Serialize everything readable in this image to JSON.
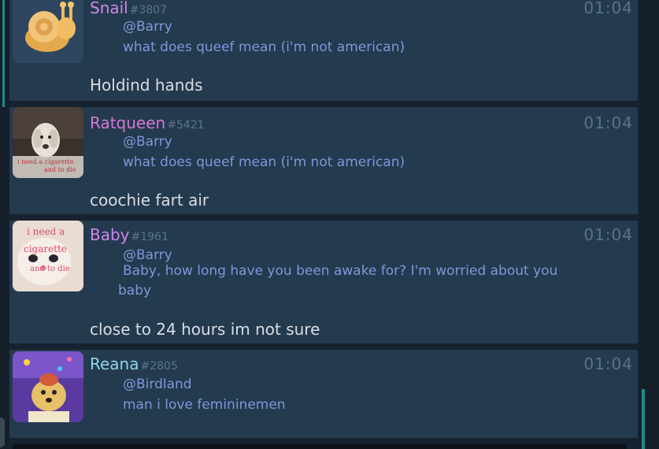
{
  "messages": [
    {
      "username": "Snail",
      "tag": "#3807",
      "time": "01:04",
      "name_color": "#cc88e8",
      "reply_to": "@Barry",
      "quoted_text": "what does queef mean (i'm not american)",
      "text": "Holdind hands",
      "avatar_icon": "snail-plush-avatar"
    },
    {
      "username": "Ratqueen",
      "tag": "#5421",
      "time": "01:04",
      "name_color": "#d678d6",
      "reply_to": "@Barry",
      "quoted_text": "what does queef mean (i'm not american)",
      "text": "coochie fart air",
      "avatar_icon": "dog-cigarette-avatar"
    },
    {
      "username": "Baby",
      "tag": "#1961",
      "time": "01:04",
      "name_color": "#cc88e8",
      "reply_to": "@Barry",
      "quoted_text_line1": "Baby, how long have you been awake for? I'm worried about you",
      "quoted_text_line2": "baby",
      "text": "close to 24 hours im not sure",
      "avatar_icon": "cat-cigarette-avatar",
      "avatar_text": "i need a cigarette"
    },
    {
      "username": "Reana",
      "tag": "#2805",
      "time": "01:04",
      "name_color": "#8fd6e8",
      "reply_to": "@Birdland",
      "quoted_text": "man i love femininemen",
      "avatar_icon": "puppy-party-avatar"
    }
  ],
  "colors": {
    "accent": "#1e8a8f",
    "card_bg": "#243a4f",
    "feed_bg": "#16222f",
    "mention": "#8097d8",
    "timestamp": "#5b7385"
  }
}
